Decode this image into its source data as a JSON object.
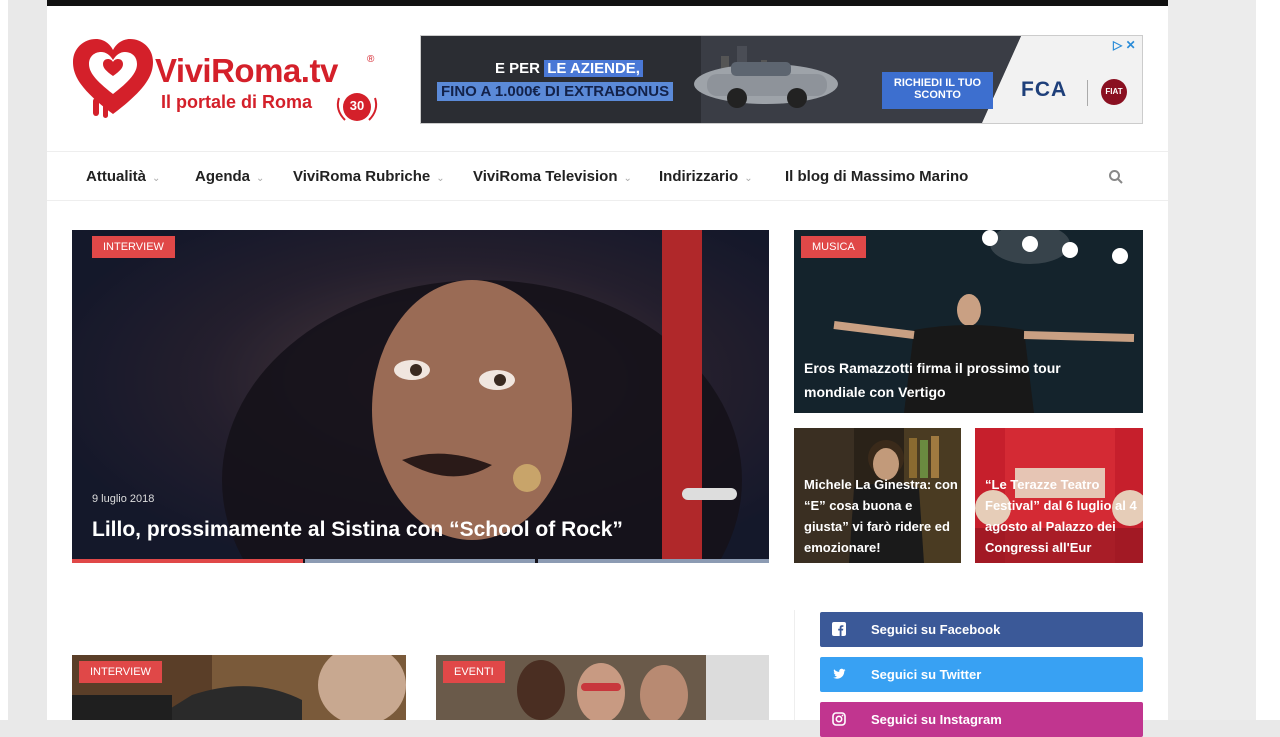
{
  "logo": {
    "title": "ViviRoma.tv",
    "registered": "®",
    "subtitle": "Il portale di Roma",
    "badge": "30"
  },
  "ad": {
    "line1_prefix": "E PER ",
    "line1_highlight": "LE AZIENDE,",
    "line2": "FINO A 1.000€ DI EXTRABONUS",
    "button": "RICHIEDI IL TUO SCONTO",
    "brand": "FCA",
    "brand2": "FIAT",
    "close": "▷ ✕"
  },
  "nav": {
    "items": [
      {
        "label": "Attualità",
        "caret": "⌄"
      },
      {
        "label": "Agenda",
        "caret": "⌄"
      },
      {
        "label": "ViviRoma Rubriche",
        "caret": "⌄"
      },
      {
        "label": "ViviRoma Television",
        "caret": "⌄"
      },
      {
        "label": "Indirizzario",
        "caret": "⌄"
      },
      {
        "label": "Il blog di Massimo Marino",
        "caret": ""
      }
    ]
  },
  "hero": {
    "tag": "INTERVIEW",
    "date": "9 luglio 2018",
    "title": "Lillo, prossimamente al Sistina con “School of Rock”"
  },
  "cards": [
    {
      "tag": "MUSICA",
      "title": "Eros Ramazzotti firma il prossimo tour mondiale con Vertigo"
    },
    {
      "title": "Michele La Ginestra: con “E” cosa buona e giusta” vi farò ridere ed emozionare!"
    },
    {
      "title": "“Le Terazze Teatro Festival” dal 6 luglio al 4 agosto al Palazzo dei Congressi all'Eur"
    }
  ],
  "social": [
    {
      "label": "Seguici su Facebook",
      "color": "#3b5998"
    },
    {
      "label": "Seguici su Twitter",
      "color": "#38a1f3"
    },
    {
      "label": "Seguici su Instagram",
      "color": "#c1358f"
    }
  ],
  "bottom": [
    {
      "tag": "INTERVIEW"
    },
    {
      "tag": "EVENTI"
    }
  ],
  "colors": {
    "brand_red": "#d4202a",
    "tag_red": "#e04848"
  }
}
